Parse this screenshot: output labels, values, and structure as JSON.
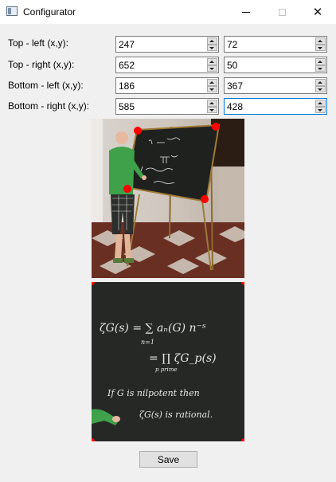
{
  "window": {
    "title": "Configurator"
  },
  "rows": [
    {
      "label": "Top - left (x,y):",
      "x": "247",
      "y": "72"
    },
    {
      "label": "Top - right (x,y):",
      "x": "652",
      "y": "50"
    },
    {
      "label": "Bottom - left (x,y):",
      "x": "186",
      "y": "367"
    },
    {
      "label": "Bottom - right (x,y):",
      "x": "585",
      "y": "428"
    }
  ],
  "buttons": {
    "save": "Save"
  },
  "colors": {
    "marker": "#ff0000",
    "board": "#262826",
    "focus": "#0078d7"
  },
  "board_text": [
    "ζG(s) = ∑ aₙ(G) n⁻ˢ",
    "n=1",
    "= ∏ ζG_p(s)",
    "p prime",
    "If G is nilpotent then",
    "ζG(s) is rational."
  ]
}
